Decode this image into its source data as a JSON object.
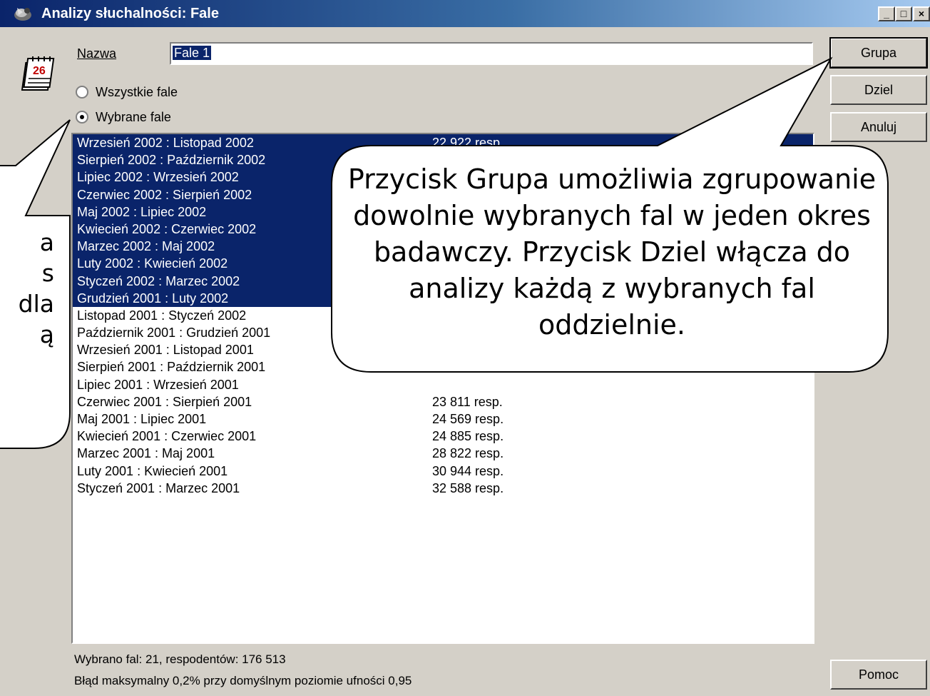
{
  "window": {
    "title": "Analizy słuchalności: Fale",
    "controls": {
      "minimize": "_",
      "maximize": "□",
      "close": "×"
    }
  },
  "form": {
    "name_label": "Nazwa",
    "name_value": "Fale 1",
    "radio_all_label": "Wszystkie fale",
    "radio_selected_label": "Wybrane fale",
    "selected_option": "Wybrane fale"
  },
  "calendar_icon_day": "26",
  "waves": [
    {
      "name": "Wrzesień 2002 : Listopad 2002",
      "resp": "22 922 resp.",
      "selected": true
    },
    {
      "name": "Sierpień 2002 : Październik 2002",
      "resp": "",
      "selected": true
    },
    {
      "name": "Lipiec 2002 : Wrzesień 2002",
      "resp": "",
      "selected": true
    },
    {
      "name": "Czerwiec 2002 : Sierpień 2002",
      "resp": "",
      "selected": true
    },
    {
      "name": "Maj 2002 : Lipiec 2002",
      "resp": "",
      "selected": true
    },
    {
      "name": "Kwiecień 2002 : Czerwiec 2002",
      "resp": "",
      "selected": true
    },
    {
      "name": "Marzec 2002 : Maj 2002",
      "resp": "",
      "selected": true
    },
    {
      "name": "Luty 2002 : Kwiecień 2002",
      "resp": "",
      "selected": true
    },
    {
      "name": "Styczeń 2002 : Marzec 2002",
      "resp": "",
      "selected": true
    },
    {
      "name": "Grudzień 2001 : Luty 2002",
      "resp": "",
      "selected": true
    },
    {
      "name": "Listopad 2001 : Styczeń 2002",
      "resp": "",
      "selected": false
    },
    {
      "name": "Październik 2001 : Grudzień 2001",
      "resp": "",
      "selected": false
    },
    {
      "name": "Wrzesień 2001 : Listopad 2001",
      "resp": "",
      "selected": false
    },
    {
      "name": "Sierpień 2001 : Październik 2001",
      "resp": "",
      "selected": false
    },
    {
      "name": "Lipiec 2001 : Wrzesień 2001",
      "resp": "",
      "selected": false
    },
    {
      "name": "Czerwiec 2001 : Sierpień 2001",
      "resp": "23 811 resp.",
      "selected": false
    },
    {
      "name": "Maj 2001 : Lipiec 2001",
      "resp": "24 569 resp.",
      "selected": false
    },
    {
      "name": "Kwiecień 2001 : Czerwiec 2001",
      "resp": "24 885 resp.",
      "selected": false
    },
    {
      "name": "Marzec 2001 : Maj 2001",
      "resp": "28 822 resp.",
      "selected": false
    },
    {
      "name": "Luty 2001 : Kwiecień 2001",
      "resp": "30 944 resp.",
      "selected": false
    },
    {
      "name": "Styczeń 2001 : Marzec 2001",
      "resp": "32 588 resp.",
      "selected": false
    }
  ],
  "buttons": {
    "group": "Grupa",
    "split": "Dziel",
    "cancel": "Anuluj",
    "help": "Pomoc"
  },
  "status": {
    "line1": "Wybrano fal: 21, respodentów: 176 513",
    "line2": "Błąd maksymalny 0,2% przy domyślnym poziomie ufności 0,95"
  },
  "callout_main": "Przycisk Grupa umożliwia zgrupowanie dowolnie wybranych fal w jeden okres badawczy. Przycisk Dziel włącza do analizy każdą z wybranych fal oddzielnie.",
  "callout_left_fragments": [
    "a",
    "s",
    "dla",
    "ą"
  ],
  "colors": {
    "selection": "#0a246a",
    "dialog_face": "#d4d0c8",
    "title_gradient_start": "#0a246a",
    "title_gradient_end": "#a6caf0"
  }
}
